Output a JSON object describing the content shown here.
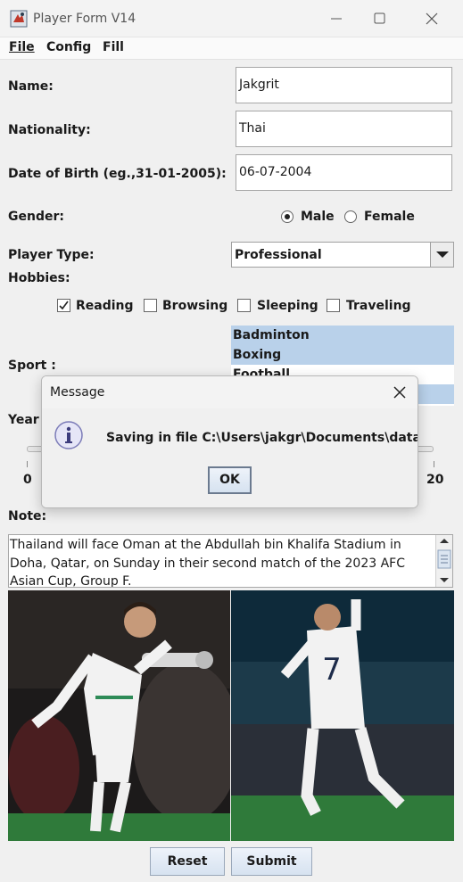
{
  "window": {
    "title": "Player Form V14"
  },
  "menu": {
    "file": "File",
    "config": "Config",
    "fill": "Fill"
  },
  "form": {
    "name_label": "Name:",
    "name_value": "Jakgrit",
    "nationality_label": "Nationality:",
    "nationality_value": "Thai",
    "dob_label": "Date of Birth (eg.,31-01-2005):",
    "dob_value": "06-07-2004",
    "gender_label": "Gender:",
    "gender_options": [
      {
        "label": "Male",
        "selected": true
      },
      {
        "label": "Female",
        "selected": false
      }
    ],
    "player_type_label": "Player Type:",
    "player_type_value": "Professional",
    "hobbies_label": "Hobbies:",
    "hobbies": [
      {
        "label": "Reading",
        "checked": true
      },
      {
        "label": "Browsing",
        "checked": false
      },
      {
        "label": "Sleeping",
        "checked": false
      },
      {
        "label": "Traveling",
        "checked": false
      }
    ],
    "sport_label": "Sport :",
    "sports": [
      {
        "label": "Badminton",
        "selected": true
      },
      {
        "label": "Boxing",
        "selected": true
      },
      {
        "label": "Football",
        "selected": false
      },
      {
        "label": "",
        "selected": true
      }
    ],
    "year_label": "Year",
    "slider": {
      "min_label": "0",
      "max_label": "20"
    },
    "note_label": "Note:",
    "note_text": "Thailand will face Oman at the Abdullah bin Khalifa Stadium in Doha, Qatar, on Sunday in their second match of the 2023 AFC Asian Cup, Group F.",
    "reset_label": "Reset",
    "submit_label": "Submit"
  },
  "dialog": {
    "title": "Message",
    "message": "Saving in file C:\\Users\\jakgr\\Documents\\data.obj",
    "ok_label": "OK"
  },
  "colors": {
    "selection": "#b9d1ea",
    "pitch": "#2f7a3a"
  },
  "icons": [
    "app-icon",
    "minimize-icon",
    "maximize-icon",
    "close-icon",
    "info-icon",
    "dropdown-arrow-icon",
    "checkmark-icon"
  ]
}
